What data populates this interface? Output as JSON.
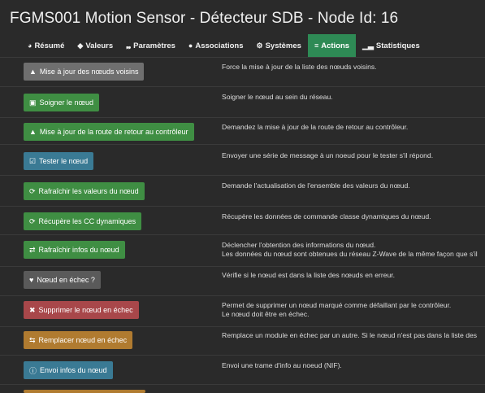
{
  "title": "FGMS001 Motion Sensor - Détecteur SDB - Node Id: 16",
  "tabs": [
    {
      "label": "Résumé",
      "icon": "dashboard-icon"
    },
    {
      "label": "Valeurs",
      "icon": "tag-icon"
    },
    {
      "label": "Paramètres",
      "icon": "wrench-icon"
    },
    {
      "label": "Associations",
      "icon": "users-icon"
    },
    {
      "label": "Systèmes",
      "icon": "cogs-icon"
    },
    {
      "label": "Actions",
      "icon": "sliders-icon",
      "active": true
    },
    {
      "label": "Statistiques",
      "icon": "bar-chart-icon"
    }
  ],
  "actions": [
    {
      "label": "Mise à jour des nœuds voisins",
      "icon": "sitemap-icon",
      "color": "#6f6f6f",
      "desc": [
        "Force la mise à jour de la liste des nœuds voisins."
      ]
    },
    {
      "label": "Soigner le nœud",
      "icon": "medkit-icon",
      "color": "#3f8e43",
      "desc": [
        "Soigner le nœud au sein du réseau."
      ]
    },
    {
      "label": "Mise à jour de la route de retour au contrôleur",
      "icon": "road-icon",
      "color": "#3f8e43",
      "desc": [
        "Demandez la mise à jour de la route de retour au contrôleur."
      ]
    },
    {
      "label": "Tester le nœud",
      "icon": "check-square-icon",
      "color": "#3a7a94",
      "desc": [
        "Envoyer une série de message à un noeud pour le tester s'il répond."
      ]
    },
    {
      "label": "Rafraîchir les valeurs du nœud",
      "icon": "refresh-icon",
      "color": "#3f8e43",
      "desc": [
        "Demande l'actualisation de l'ensemble des valeurs du nœud."
      ]
    },
    {
      "label": "Récupère les CC dynamiques",
      "icon": "refresh-icon",
      "color": "#3f8e43",
      "desc": [
        "Récupère les données de commande classe dynamiques du nœud."
      ]
    },
    {
      "label": "Rafraîchir infos du nœud",
      "icon": "retweet-icon",
      "color": "#3f8e43",
      "desc": [
        "Déclencher l'obtention des informations du nœud.",
        "Les données du nœud sont obtenues du réseau Z-Wave de la même façon que s'il"
      ]
    },
    {
      "label": "Nœud en échec ?",
      "icon": "heartbeat-icon",
      "color": "#5a5a5a",
      "desc": [
        "Vérifie si le nœud est dans la liste des nœuds en erreur."
      ]
    },
    {
      "label": "Supprimer le nœud en échec",
      "icon": "times-icon",
      "color": "#a8474a",
      "desc": [
        "Permet de supprimer un nœud marqué comme défaillant par le contrôleur.",
        "Le nœud doit être en échec."
      ]
    },
    {
      "label": "Remplacer nœud en échec",
      "icon": "exchange-icon",
      "color": "#b07b30",
      "desc": [
        "Remplace un module en échec par un autre. Si le nœud n'est pas dans la liste des"
      ]
    },
    {
      "label": "Envoi infos du nœud",
      "icon": "info-circle-icon",
      "color": "#3a7a94",
      "desc": [
        "Envoi une trame d'info au noeud (NIF)."
      ]
    }
  ]
}
